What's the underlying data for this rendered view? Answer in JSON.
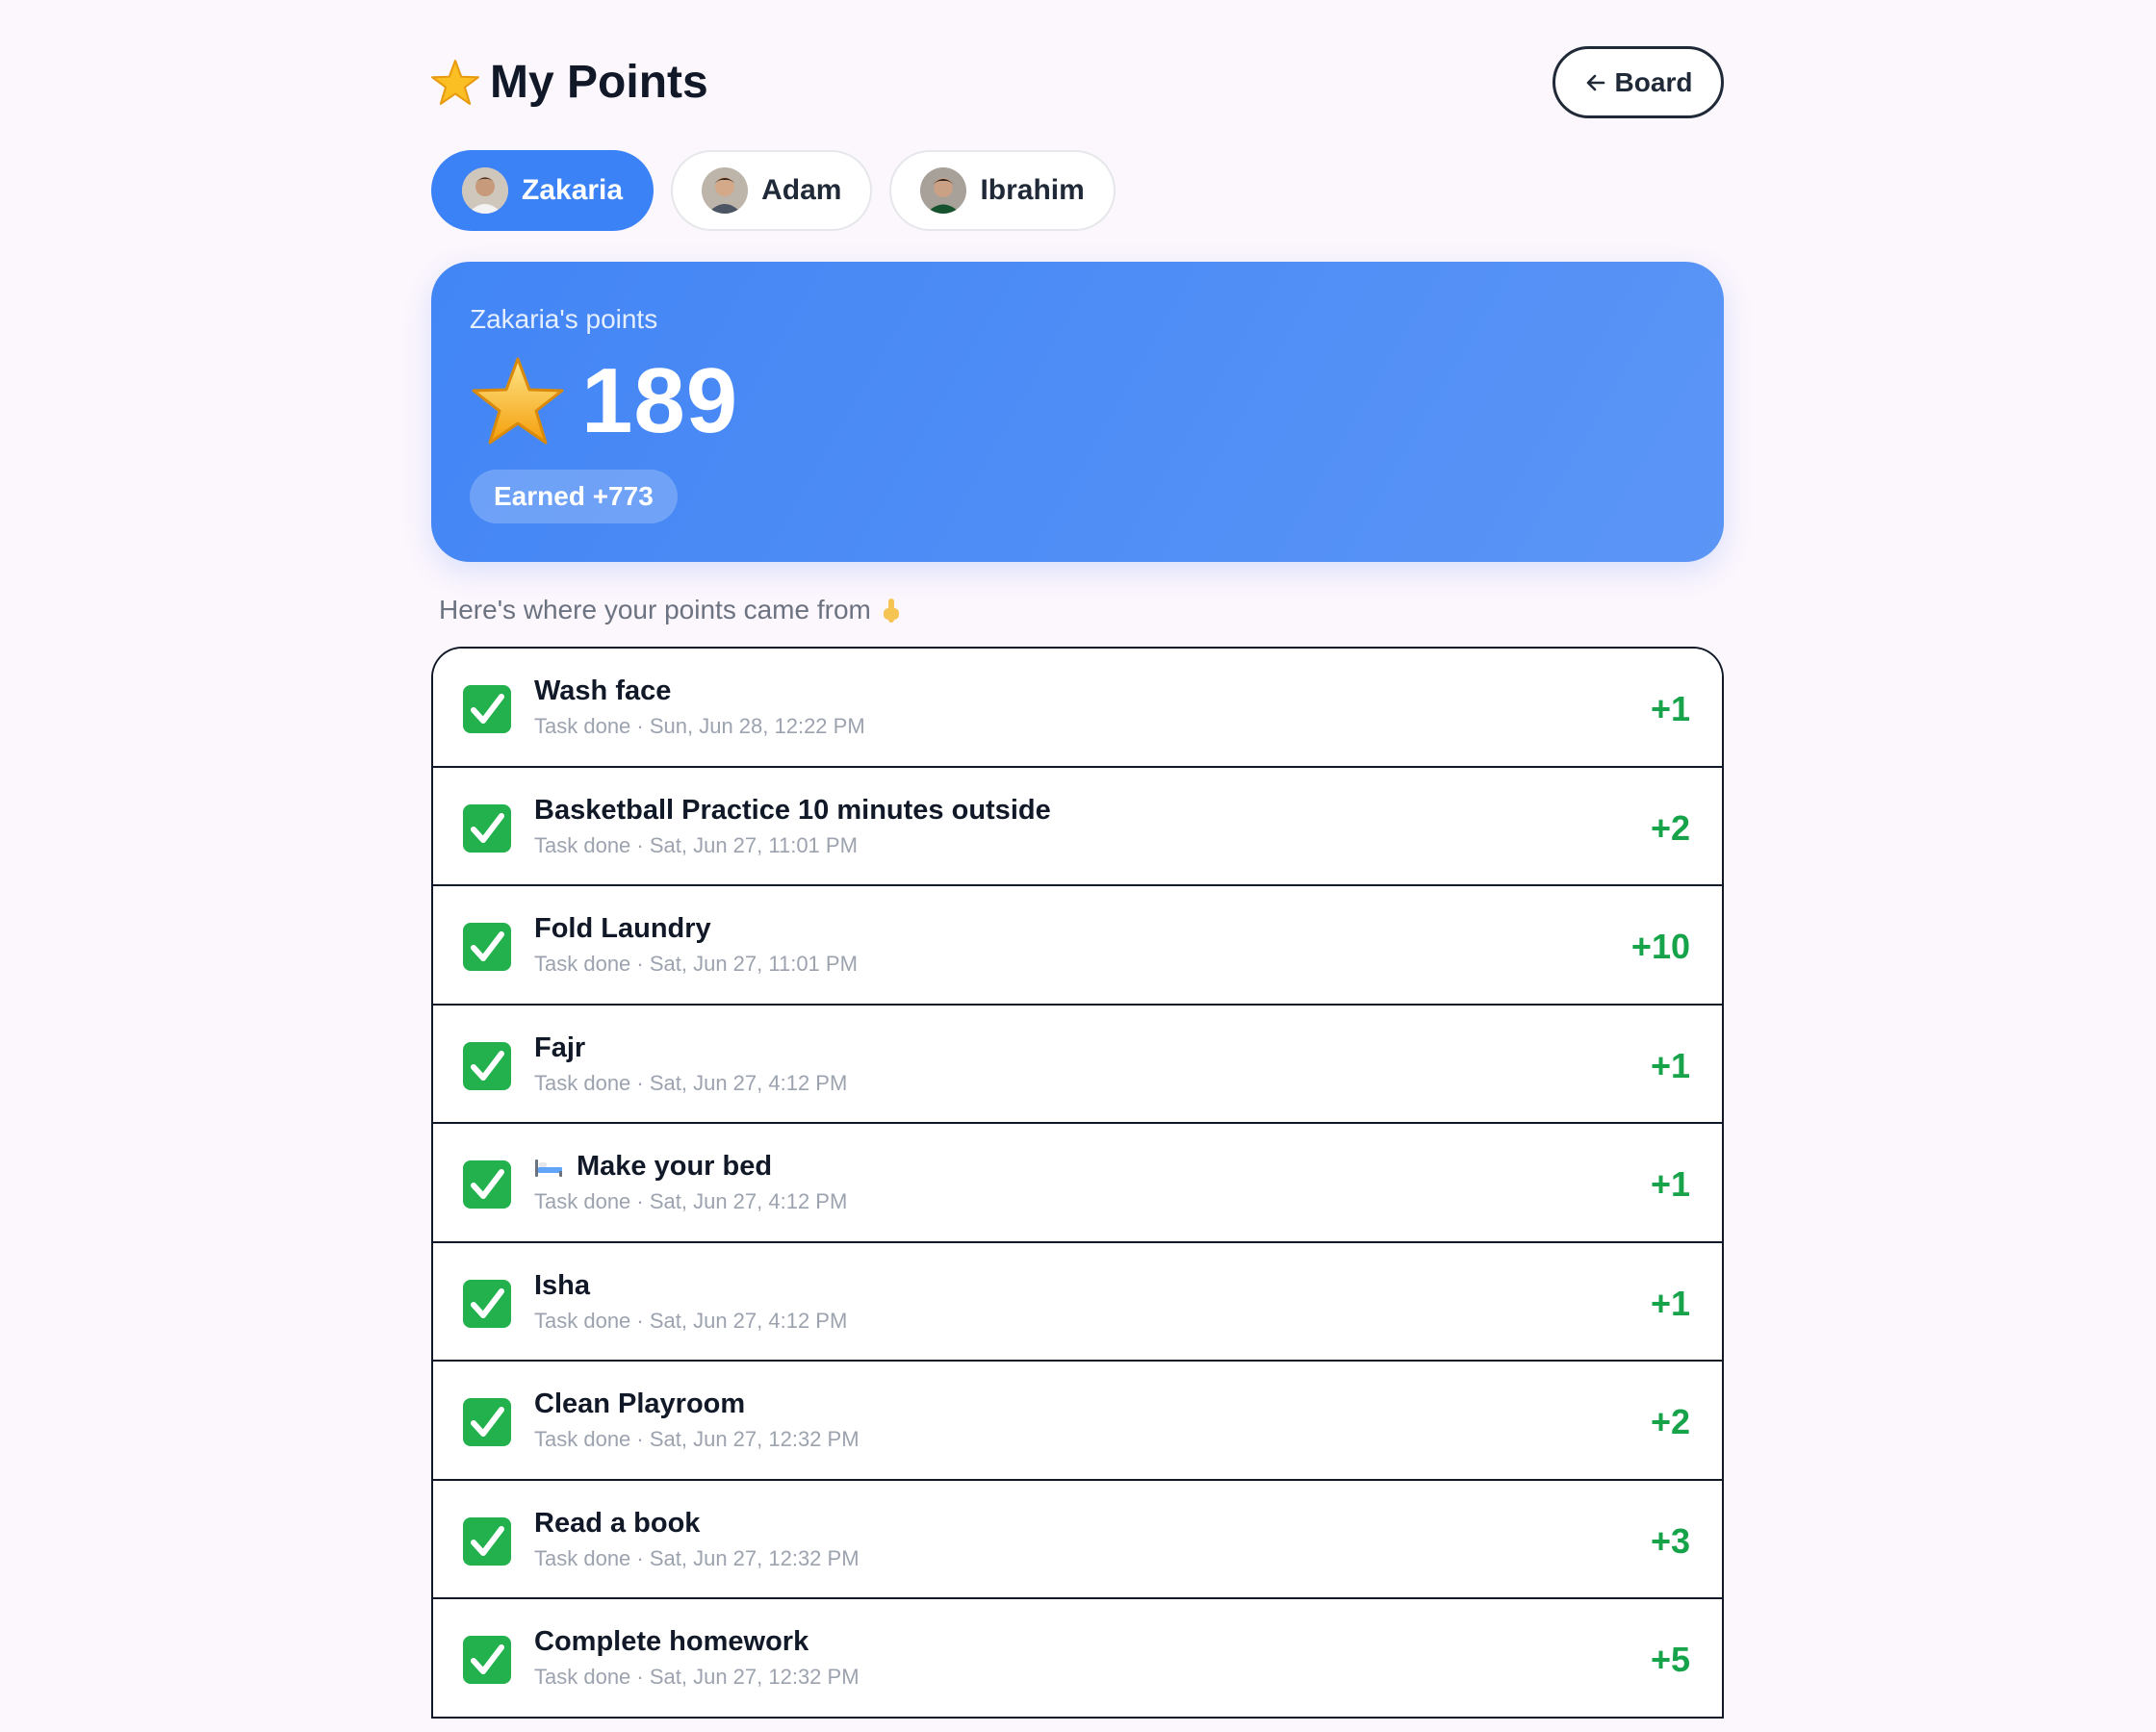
{
  "header": {
    "title": "My Points",
    "title_icon": "star-icon",
    "board_button": "Board"
  },
  "tabs": [
    {
      "label": "Zakaria",
      "active": true
    },
    {
      "label": "Adam",
      "active": false
    },
    {
      "label": "Ibrahim",
      "active": false
    }
  ],
  "points_card": {
    "label": "Zakaria's points",
    "value": "189",
    "earned": "Earned +773",
    "color": "#3b82f6"
  },
  "hint": "Here's where your points came from",
  "history": [
    {
      "title": "Wash face",
      "meta": "Task done · Sun, Jun 28, 12:22 PM",
      "points": "+1"
    },
    {
      "title": "Basketball Practice 10 minutes outside",
      "meta": "Task done · Sat, Jun 27, 11:01 PM",
      "points": "+2"
    },
    {
      "title": "Fold Laundry",
      "meta": "Task done · Sat, Jun 27, 11:01 PM",
      "points": "+10"
    },
    {
      "title": "Fajr",
      "meta": "Task done · Sat, Jun 27, 4:12 PM",
      "points": "+1"
    },
    {
      "title": "Make your bed",
      "meta": "Task done · Sat, Jun 27, 4:12 PM",
      "points": "+1",
      "icon": "bed-icon"
    },
    {
      "title": "Isha",
      "meta": "Task done · Sat, Jun 27, 4:12 PM",
      "points": "+1"
    },
    {
      "title": "Clean Playroom",
      "meta": "Task done · Sat, Jun 27, 12:32 PM",
      "points": "+2"
    },
    {
      "title": "Read a book",
      "meta": "Task done · Sat, Jun 27, 12:32 PM",
      "points": "+3"
    },
    {
      "title": "Complete homework",
      "meta": "Task done · Sat, Jun 27, 12:32 PM",
      "points": "+5"
    }
  ],
  "colors": {
    "accent": "#3b82f6",
    "points_green": "#16a34a",
    "background": "#fcf6fd"
  }
}
